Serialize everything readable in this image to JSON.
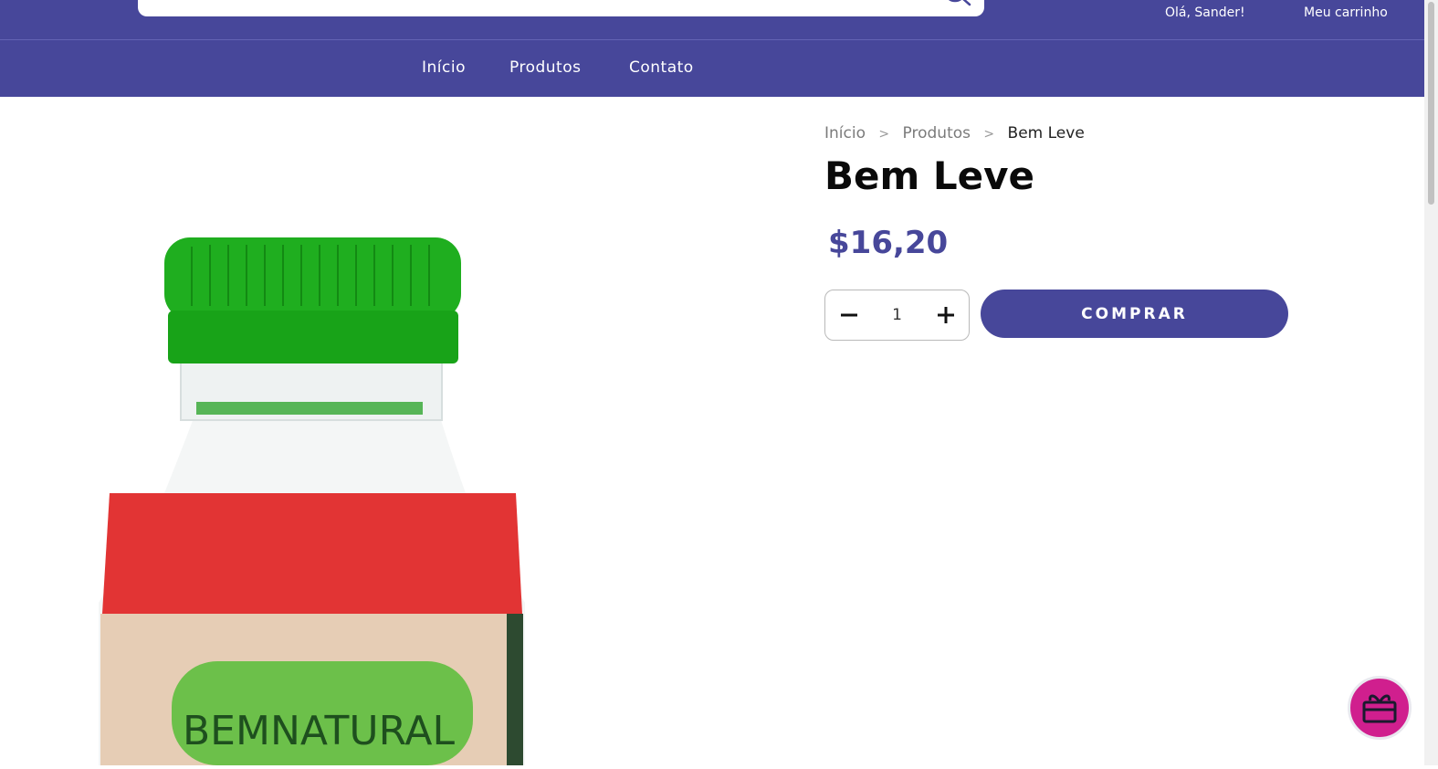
{
  "header": {
    "search": {
      "value": "",
      "placeholder": ""
    },
    "greeting": "Olá, Sander!",
    "cart_label": "Meu carrinho"
  },
  "nav": {
    "items": [
      {
        "label": "Início"
      },
      {
        "label": "Produtos"
      },
      {
        "label": "Contato"
      }
    ]
  },
  "breadcrumb": {
    "items": [
      "Início",
      "Produtos",
      "Bem Leve"
    ],
    "separator": ">"
  },
  "product": {
    "title": "Bem Leve",
    "price": "$16,20",
    "quantity": "1",
    "buy_label": "COMPRAR",
    "image_brand": "BEMNATURAL"
  },
  "colors": {
    "brand": "#47479a",
    "accent": "#d01f8e",
    "cap_green": "#1fae1f",
    "juice_red": "#e23434"
  },
  "icons": {
    "search": "search-icon",
    "minus": "minus-icon",
    "plus": "plus-icon",
    "gift": "gift-icon"
  }
}
